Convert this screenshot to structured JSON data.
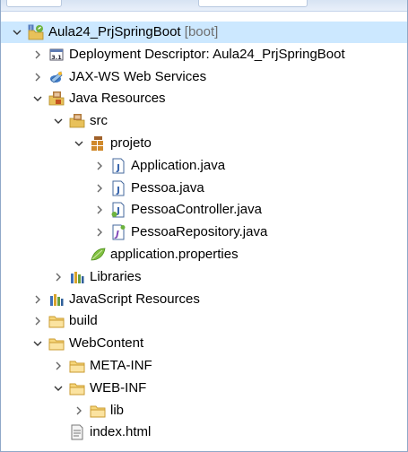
{
  "project_explorer": {
    "tree": [
      {
        "level": 0,
        "expanded": true,
        "icon": "spring-project-icon",
        "label": "Aula24_PrjSpringBoot",
        "decoration": "[boot]",
        "selected": true
      },
      {
        "level": 1,
        "expanded": false,
        "icon": "deployment-descriptor-icon",
        "label": "Deployment Descriptor: Aula24_PrjSpringBoot"
      },
      {
        "level": 1,
        "expanded": false,
        "icon": "web-services-icon",
        "label": "JAX-WS Web Services"
      },
      {
        "level": 1,
        "expanded": true,
        "icon": "java-resources-icon",
        "label": "Java Resources"
      },
      {
        "level": 2,
        "expanded": true,
        "icon": "source-folder-icon",
        "label": "src"
      },
      {
        "level": 3,
        "expanded": true,
        "icon": "package-icon",
        "label": "projeto"
      },
      {
        "level": 4,
        "expanded": false,
        "icon": "java-file-icon",
        "label": "Application.java"
      },
      {
        "level": 4,
        "expanded": false,
        "icon": "java-file-icon",
        "label": "Pessoa.java"
      },
      {
        "level": 4,
        "expanded": false,
        "icon": "java-controller-file-icon",
        "label": "PessoaController.java"
      },
      {
        "level": 4,
        "expanded": false,
        "icon": "java-interface-file-icon",
        "label": "PessoaRepository.java"
      },
      {
        "level": 3,
        "icon": "properties-file-icon",
        "label": "application.properties"
      },
      {
        "level": 2,
        "expanded": false,
        "icon": "libraries-icon",
        "label": "Libraries"
      },
      {
        "level": 1,
        "expanded": false,
        "icon": "javascript-resources-icon",
        "label": "JavaScript Resources"
      },
      {
        "level": 1,
        "expanded": false,
        "icon": "folder-icon",
        "label": "build"
      },
      {
        "level": 1,
        "expanded": true,
        "icon": "folder-icon",
        "label": "WebContent"
      },
      {
        "level": 2,
        "expanded": false,
        "icon": "folder-icon",
        "label": "META-INF"
      },
      {
        "level": 2,
        "expanded": true,
        "icon": "folder-icon",
        "label": "WEB-INF"
      },
      {
        "level": 3,
        "expanded": false,
        "icon": "folder-icon",
        "label": "lib"
      },
      {
        "level": 2,
        "icon": "html-file-icon",
        "label": "index.html"
      }
    ]
  }
}
